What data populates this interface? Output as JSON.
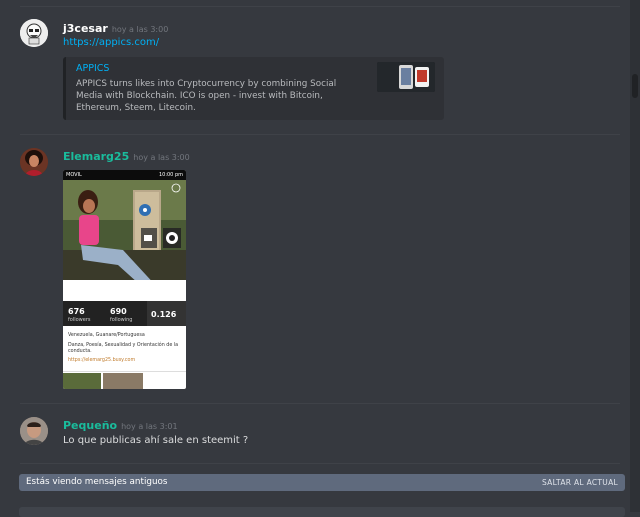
{
  "messages": [
    {
      "username": "j3cesar",
      "username_color": "#ffffff",
      "timestamp": "hoy a las 3:00",
      "link": "https://appics.com/",
      "embed": {
        "title": "APPICS",
        "description": "APPICS turns likes into Cryptocurrency by combining Social Media with Blockchain. ICO is open - invest with Bitcoin, Ethereum, Steem, Litecoin."
      }
    },
    {
      "username": "Elemarg25",
      "username_color": "#1abc9c",
      "timestamp": "hoy a las 3:00",
      "attachment": {
        "status_left": "MOVIL",
        "status_right": "10:00 pm",
        "profile_name": "elemarg25",
        "followers_value": "676",
        "followers_label": "followers",
        "following_value": "690",
        "following_label": "following",
        "sp_value": "0.126",
        "bio_location": "Venezuela, Guanare/Portuguesa",
        "bio_text": "Danza, Poesía, Sexualidad y Orientación de la conducta.",
        "bio_link": "https://elemarg25.busy.com"
      }
    },
    {
      "username": "Pequeño",
      "username_color": "#1abc9c",
      "timestamp": "hoy a las 3:01",
      "text": "Lo que publicas ahí sale en steemit ?"
    }
  ],
  "banner": {
    "text": "Estás viendo mensajes antiguos",
    "action": "SALTAR AL ACTUAL"
  },
  "colors": {
    "background": "#36393f",
    "link": "#00b0f4",
    "banner": "#5f6a7d"
  }
}
